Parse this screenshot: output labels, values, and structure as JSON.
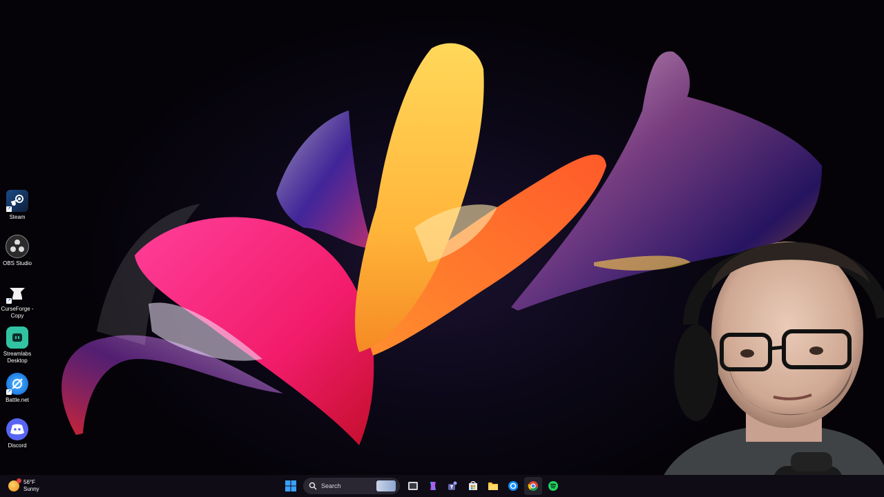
{
  "desktop_icons": [
    {
      "label": "Steam",
      "icon": "steam-icon"
    },
    {
      "label": "OBS Studio",
      "icon": "obs-icon"
    },
    {
      "label": "CurseForge -\nCopy",
      "label_line1": "CurseForge -",
      "label_line2": "Copy",
      "icon": "curseforge-icon"
    },
    {
      "label": "Streamlabs Desktop",
      "label_line1": "Streamlabs",
      "label_line2": "Desktop",
      "icon": "streamlabs-icon"
    },
    {
      "label": "Battle.net",
      "icon": "battlenet-icon"
    },
    {
      "label": "Discord",
      "icon": "discord-icon"
    }
  ],
  "taskbar": {
    "weather": {
      "temperature": "56°F",
      "condition": "Sunny",
      "icon": "sun-icon"
    },
    "search_label": "Search",
    "pinned_apps": [
      "windows-start-icon",
      "search-icon",
      "task-view-icon",
      "copilot-icon",
      "teams-icon",
      "store-icon",
      "file-explorer-icon",
      "battlenet-icon",
      "chrome-icon",
      "spotify-icon"
    ]
  },
  "colors": {
    "taskbar_bg": "#0f0c16",
    "desktop_bg": "#07050d",
    "accent": "#0078d4"
  }
}
